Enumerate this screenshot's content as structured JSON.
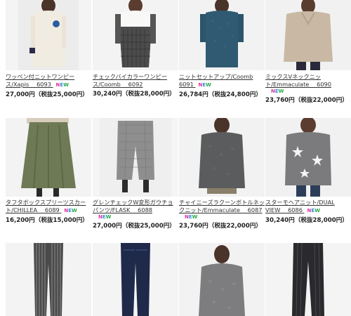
{
  "new_badge": "NEW",
  "products": [
    {
      "title_1": "ワッペン付ニットワンピー",
      "title_2": "ス/Xapis　 6093",
      "price": "27,000円（税抜25,000円）",
      "new": true
    },
    {
      "title_1": "チェックバイカラーワンピー",
      "title_2": "ス/Coomb　 6092",
      "price": "30,240円（税抜28,000円）",
      "new": false
    },
    {
      "title_1": "ニットセットアップ/Coomb",
      "title_2": "6091",
      "price": "26,784円（税抜24,800円）",
      "new": true
    },
    {
      "title_1": "ミックスVネックニッ",
      "title_2": "ト/Emmaculate　 6090",
      "price": "23,760円（税抜22,000円）",
      "new": true
    },
    {
      "title_1": "タフタボックスプリーツスカー",
      "title_2": "ト/CHILLEA　 6089",
      "price": "16,200円（税抜15,000円）",
      "new": true
    },
    {
      "title_1": "グレンチェックW変形ガウチョ",
      "title_2": "パンツ/FLASK　 6088",
      "price": "27,000円（税抜25,000円）",
      "new": true
    },
    {
      "title_1": "チャイニーズラクーンボトルネッ",
      "title_2": "クニット/Emmaculate　 6087",
      "price": "23,760円（税抜22,000円）",
      "new": true
    },
    {
      "title_1": "スターモヘアニット/DUAL",
      "title_2": "VIEW　 6086",
      "price": "30,240円（税抜28,000円）",
      "new": true
    }
  ]
}
